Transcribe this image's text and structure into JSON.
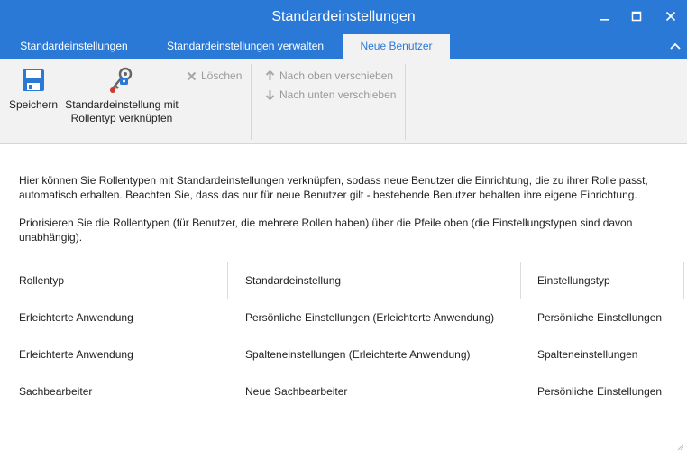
{
  "window": {
    "title": "Standardeinstellungen",
    "minimize_icon": "minimize-icon",
    "maximize_icon": "maximize-icon",
    "close_icon": "close-icon"
  },
  "tabs": [
    {
      "label": "Standardeinstellungen",
      "active": false
    },
    {
      "label": "Standardeinstellungen verwalten",
      "active": false
    },
    {
      "label": "Neue Benutzer",
      "active": true
    }
  ],
  "ribbon": {
    "save_label": "Speichern",
    "link_label_line1": "Standardeinstellung mit",
    "link_label_line2": "Rollentyp verknüpfen",
    "delete_label": "Löschen",
    "move_up_label": "Nach oben verschieben",
    "move_down_label": "Nach unten verschieben"
  },
  "description": {
    "paragraph1": "Hier können Sie Rollentypen mit Standardeinstellungen verknüpfen, sodass neue Benutzer die Einrichtung, die zu ihrer Rolle passt, automatisch erhalten. Beachten Sie, dass das nur für neue Benutzer gilt - bestehende Benutzer behalten ihre eigene Einrichtung.",
    "paragraph2": "Priorisieren Sie die Rollentypen (für Benutzer, die mehrere Rollen haben) über die Pfeile oben (die Einstellungstypen sind davon unabhängig)."
  },
  "table": {
    "columns": [
      "Rollentyp",
      "Standardeinstellung",
      "Einstellungstyp"
    ],
    "rows": [
      [
        "Erleichterte Anwendung",
        "Persönliche Einstellungen (Erleichterte Anwendung)",
        "Persönliche Einstellungen"
      ],
      [
        "Erleichterte Anwendung",
        "Spalteneinstellungen (Erleichterte Anwendung)",
        "Spalteneinstellungen"
      ],
      [
        "Sachbearbeiter",
        "Neue Sachbearbeiter",
        "Persönliche Einstellungen"
      ]
    ]
  },
  "colors": {
    "accent": "#2b79d6",
    "ribbon_bg": "#f2f2f2",
    "disabled_text": "#9a9a9a"
  }
}
